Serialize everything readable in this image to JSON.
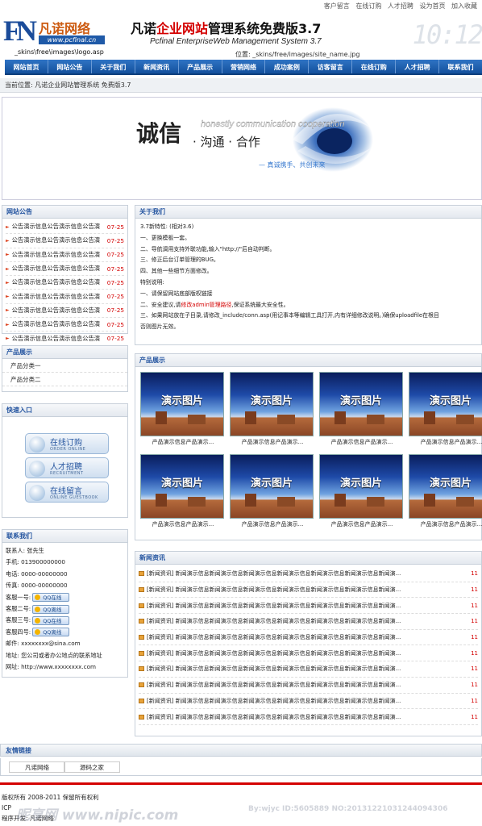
{
  "top_links": [
    "客户留言",
    "在线订购",
    "人才招聘",
    "设为首页",
    "加入收藏"
  ],
  "header": {
    "logo_fn": "FN",
    "logo_cn": "凡诺网络",
    "logo_url": "www.pcfinal.cn",
    "logo_path": "_skins\\free\\images\\logo.asp",
    "title_pre": "凡诺",
    "title_red": "企业网站",
    "title_post": "管理系统免费版3.7",
    "subtitle": "Pcfinal EnterpriseWeb Management System 3.7",
    "position": "位置: _skins/free/images/site_name.jpg",
    "clock": "10:12"
  },
  "nav": [
    "网站首页",
    "网站公告",
    "关于我们",
    "新闻资讯",
    "产品展示",
    "营销网络",
    "成功案例",
    "访客留言",
    "在线订购",
    "人才招聘",
    "联系我们"
  ],
  "breadcrumb": "当前位置: 凡诺企业网站管理系统 免费版3.7",
  "banner": {
    "chengxin": "诚信",
    "english": "honestly communication cooperation",
    "goutong": "· 沟通 · 合作",
    "slogan": "— 真诚携手、共创未来"
  },
  "notice": {
    "title": "网站公告",
    "items": [
      {
        "text": "公告演示信息公告演示信息公告演",
        "date": "07-25"
      },
      {
        "text": "公告演示信息公告演示信息公告演",
        "date": "07-25"
      },
      {
        "text": "公告演示信息公告演示信息公告演",
        "date": "07-25"
      },
      {
        "text": "公告演示信息公告演示信息公告演",
        "date": "07-25"
      },
      {
        "text": "公告演示信息公告演示信息公告演",
        "date": "07-25"
      },
      {
        "text": "公告演示信息公告演示信息公告演",
        "date": "07-25"
      },
      {
        "text": "公告演示信息公告演示信息公告演",
        "date": "07-25"
      },
      {
        "text": "公告演示信息公告演示信息公告演",
        "date": "07-25"
      },
      {
        "text": "公告演示信息公告演示信息公告演",
        "date": "07-25"
      }
    ]
  },
  "product_cats": {
    "title": "产品展示",
    "items": [
      "产品分类一",
      "产品分类二"
    ]
  },
  "quick": {
    "title": "快速入口",
    "buttons": [
      {
        "cn": "在线订购",
        "en": "ORDER ONLINE"
      },
      {
        "cn": "人才招聘",
        "en": "RECRUITMENT"
      },
      {
        "cn": "在线留言",
        "en": "ONLINE GUESTBOOK"
      }
    ]
  },
  "contact": {
    "title": "联系我们",
    "person": "联系人: 张先生",
    "mobile": "手机: 013900000000",
    "phone": "电话: 0000-00000000",
    "fax": "传真: 0000-00000000",
    "service": [
      {
        "label": "客服一号:",
        "qq": "QQ在线"
      },
      {
        "label": "客服二号:",
        "qq": "QQ离线"
      },
      {
        "label": "客服三号:",
        "qq": "QQ在线"
      },
      {
        "label": "客服四号:",
        "qq": "QQ离线"
      }
    ],
    "email": "邮件: xxxxxxxx@sina.com",
    "address": "地址: 您公司或者办公地点的联系地址",
    "website": "网址: http://www.xxxxxxxx.com"
  },
  "about": {
    "title": "关于我们",
    "lines": [
      "3.7新特性: (相对3.6)",
      "一、更换模板一套。",
      "二、导航调用支持外联功能,输入\"http://\"后自动判断。",
      "三、修正后台订单管理的BUG。",
      "四、其他一些细节方面修改。",
      "特别说明:",
      "一、请保留网站底部版权链接"
    ],
    "line8_pre": "二、安全建议,请",
    "line8_red": "修改admin管理路径",
    "line8_post": ",保证系统最大安全性。",
    "line9": "三、如果网站放在子目录,请修改_include/conn.asp(用记事本等编辑工具打开,内有详细修改说明。)确保uploadfile在根目",
    "line10": "否则图片无效。"
  },
  "products": {
    "title": "产品展示",
    "items": [
      {
        "image_label": "演示图片",
        "caption": "产品演示信息产品演示..."
      },
      {
        "image_label": "演示图片",
        "caption": "产品演示信息产品演示..."
      },
      {
        "image_label": "演示图片",
        "caption": "产品演示信息产品演示..."
      },
      {
        "image_label": "演示图片",
        "caption": "产品演示信息产品演示..."
      },
      {
        "image_label": "演示图片",
        "caption": "产品演示信息产品演示..."
      },
      {
        "image_label": "演示图片",
        "caption": "产品演示信息产品演示..."
      },
      {
        "image_label": "演示图片",
        "caption": "产品演示信息产品演示..."
      },
      {
        "image_label": "演示图片",
        "caption": "产品演示信息产品演示..."
      }
    ]
  },
  "news": {
    "title": "新闻资讯",
    "items": [
      {
        "text": "[新闻资讯] 新闻演示信息新闻演示信息新闻演示信息新闻演示信息新闻演示信息新闻演示信息新闻演...",
        "date": "11"
      },
      {
        "text": "[新闻资讯] 新闻演示信息新闻演示信息新闻演示信息新闻演示信息新闻演示信息新闻演示信息新闻演...",
        "date": "11"
      },
      {
        "text": "[新闻资讯] 新闻演示信息新闻演示信息新闻演示信息新闻演示信息新闻演示信息新闻演示信息新闻演...",
        "date": "11"
      },
      {
        "text": "[新闻资讯] 新闻演示信息新闻演示信息新闻演示信息新闻演示信息新闻演示信息新闻演示信息新闻演...",
        "date": "11"
      },
      {
        "text": "[新闻资讯] 新闻演示信息新闻演示信息新闻演示信息新闻演示信息新闻演示信息新闻演示信息新闻演...",
        "date": "11"
      },
      {
        "text": "[新闻资讯] 新闻演示信息新闻演示信息新闻演示信息新闻演示信息新闻演示信息新闻演示信息新闻演...",
        "date": "11"
      },
      {
        "text": "[新闻资讯] 新闻演示信息新闻演示信息新闻演示信息新闻演示信息新闻演示信息新闻演示信息新闻演...",
        "date": "11"
      },
      {
        "text": "[新闻资讯] 新闻演示信息新闻演示信息新闻演示信息新闻演示信息新闻演示信息新闻演示信息新闻演...",
        "date": "11"
      },
      {
        "text": "[新闻资讯] 新闻演示信息新闻演示信息新闻演示信息新闻演示信息新闻演示信息新闻演示信息新闻演...",
        "date": "11"
      },
      {
        "text": "[新闻资讯] 新闻演示信息新闻演示信息新闻演示信息新闻演示信息新闻演示信息新闻演示信息新闻演...",
        "date": "11"
      }
    ]
  },
  "friend_links": {
    "title": "友情链接",
    "items": [
      "凡诺网络",
      "源码之家"
    ]
  },
  "footer": {
    "copyright": "版权所有 2008-2011 保留所有权利",
    "icp": "ICP",
    "dev": "程序开发: 凡诺网络"
  },
  "watermark": {
    "left": "昵享网 www.nipic.com",
    "right": "By:wjyc   ID:5605889 NO:20131221031244094306"
  },
  "colors": {
    "nav": "#1f5aa8",
    "accent_red": "#d40000",
    "heading_blue": "#2555a0"
  }
}
